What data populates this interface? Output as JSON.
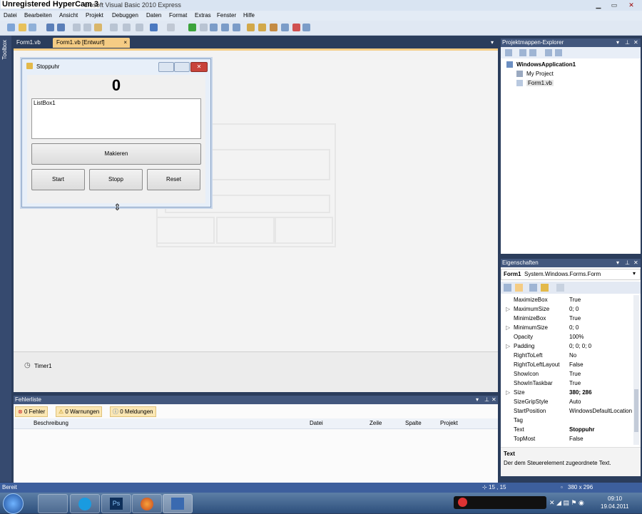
{
  "app": {
    "watermark": "Unregistered HyperCam 3",
    "title": "crosoft Visual Basic 2010 Express"
  },
  "menu": [
    "Datei",
    "Bearbeiten",
    "Ansicht",
    "Projekt",
    "Debuggen",
    "Daten",
    "Format",
    "Extras",
    "Fenster",
    "Hilfe"
  ],
  "toolbox": {
    "label": "Toolbox"
  },
  "doc_tabs": {
    "tab1": "Form1.vb",
    "tab2": "Form1.vb [Entwurf]",
    "close": "×"
  },
  "form": {
    "title": "Stoppuhr",
    "counter": "0",
    "listbox": "ListBox1",
    "btn_mark": "Makieren",
    "btn_start": "Start",
    "btn_stop": "Stopp",
    "btn_reset": "Reset"
  },
  "tray": {
    "timer": "Timer1"
  },
  "solution_explorer": {
    "title": "Projektmappen-Explorer",
    "solution": "WindowsApplication1",
    "items": [
      "My Project",
      "Form1.vb"
    ]
  },
  "properties": {
    "title": "Eigenschaften",
    "object_name": "Form1",
    "object_type": "System.Windows.Forms.Form",
    "rows": [
      {
        "exp": "",
        "name": "MaximizeBox",
        "value": "True"
      },
      {
        "exp": "▷",
        "name": "MaximumSize",
        "value": "0; 0"
      },
      {
        "exp": "",
        "name": "MinimizeBox",
        "value": "True"
      },
      {
        "exp": "▷",
        "name": "MinimumSize",
        "value": "0; 0"
      },
      {
        "exp": "",
        "name": "Opacity",
        "value": "100%"
      },
      {
        "exp": "▷",
        "name": "Padding",
        "value": "0; 0; 0; 0"
      },
      {
        "exp": "",
        "name": "RightToLeft",
        "value": "No"
      },
      {
        "exp": "",
        "name": "RightToLeftLayout",
        "value": "False"
      },
      {
        "exp": "",
        "name": "ShowIcon",
        "value": "True"
      },
      {
        "exp": "",
        "name": "ShowInTaskbar",
        "value": "True"
      },
      {
        "exp": "▷",
        "name": "Size",
        "value": "380; 286"
      },
      {
        "exp": "",
        "name": "SizeGripStyle",
        "value": "Auto"
      },
      {
        "exp": "",
        "name": "StartPosition",
        "value": "WindowsDefaultLocation"
      },
      {
        "exp": "",
        "name": "Tag",
        "value": ""
      },
      {
        "exp": "",
        "name": "Text",
        "value": "Stoppuhr"
      },
      {
        "exp": "",
        "name": "TopMost",
        "value": "False"
      }
    ],
    "desc_title": "Text",
    "desc_text": "Der dem Steuerelement zugeordnete Text."
  },
  "error_list": {
    "title": "Fehlerliste",
    "errors": "0 Fehler",
    "warnings": "0 Warnungen",
    "messages": "0 Meldungen",
    "columns": [
      "Beschreibung",
      "Datei",
      "Zeile",
      "Spalte",
      "Projekt"
    ]
  },
  "status": {
    "text": "Bereit",
    "position": "15 , 15",
    "size": "380 x 296"
  },
  "taskbar": {
    "time": "09:10",
    "date": "19.04.2011"
  },
  "colors": {
    "accent": "#f5cc84",
    "panel_title": "#42577d",
    "ide_bg": "#2b3d5c"
  }
}
